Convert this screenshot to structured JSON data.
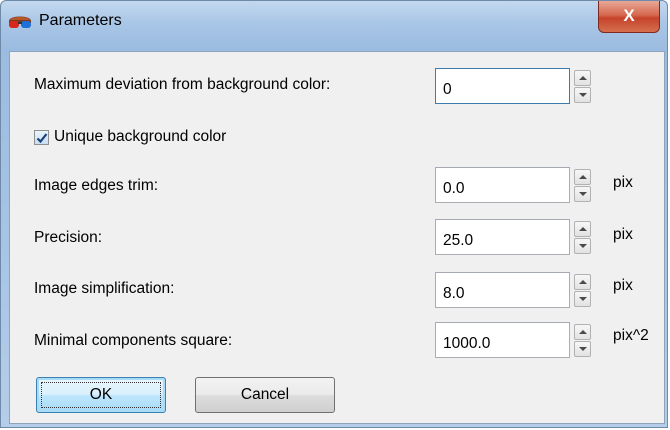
{
  "window": {
    "title": "Parameters",
    "app_icon": "3d-glasses-icon",
    "close_label": "X",
    "close_icon": "close-icon"
  },
  "fields": {
    "max_deviation": {
      "label": "Maximum deviation from background color:",
      "value": "0"
    },
    "unique_background": {
      "label": "Unique background color",
      "checked": true
    },
    "edges_trim": {
      "label": "Image edges trim:",
      "value": "0.0",
      "unit": "pix"
    },
    "precision": {
      "label": "Precision:",
      "value": "25.0",
      "unit": "pix"
    },
    "simplification": {
      "label": "Image simplification:",
      "value": "8.0",
      "unit": "pix"
    },
    "min_components": {
      "label": "Minimal components square:",
      "value": "1000.0",
      "unit": "pix^2"
    }
  },
  "buttons": {
    "ok": "OK",
    "cancel": "Cancel"
  },
  "colors": {
    "title_bar": "#a9c6e6",
    "close_button": "#c5432a",
    "dialog_face": "#f0f0f0",
    "default_button": "#bee6fd"
  }
}
